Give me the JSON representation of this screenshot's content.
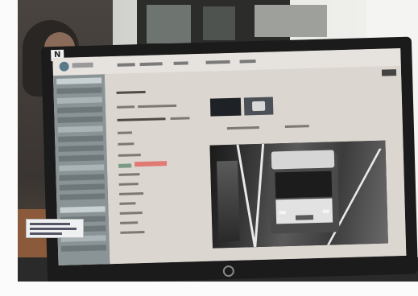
{
  "photo": {
    "subject": "",
    "monitor_badge": "N",
    "colors": {
      "screen_bg": "#d8d2cd",
      "sidebar": "#8a9496",
      "accent": "#e07a72",
      "bezel": "#1b1b1b"
    },
    "icons": [
      "logo-icon",
      "power-icon"
    ]
  }
}
